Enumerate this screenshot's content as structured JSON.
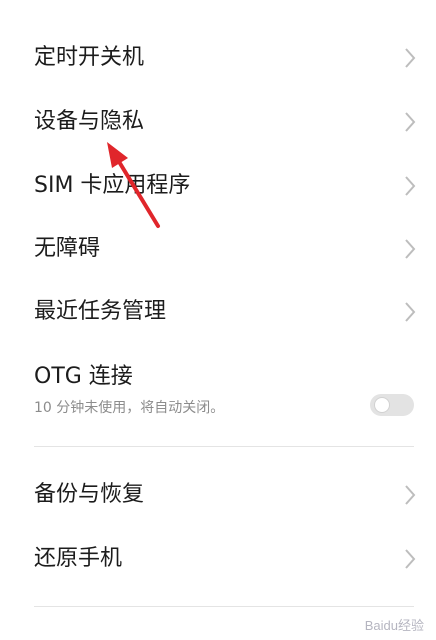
{
  "settings_list": {
    "items": [
      {
        "label": "定时开关机"
      },
      {
        "label": "设备与隐私"
      },
      {
        "label": "SIM 卡应用程序"
      },
      {
        "label": "无障碍"
      },
      {
        "label": "最近任务管理"
      }
    ],
    "otg": {
      "label": "OTG 连接",
      "description": "10 分钟未使用，将自动关闭。",
      "enabled": false
    },
    "items_after_divider": [
      {
        "label": "备份与恢复"
      },
      {
        "label": "还原手机"
      }
    ]
  },
  "annotation": {
    "arrow_color": "#e0262b"
  },
  "watermark": {
    "text": "Baidu经验"
  },
  "icons": {
    "chevron": "chevron-right-icon"
  }
}
